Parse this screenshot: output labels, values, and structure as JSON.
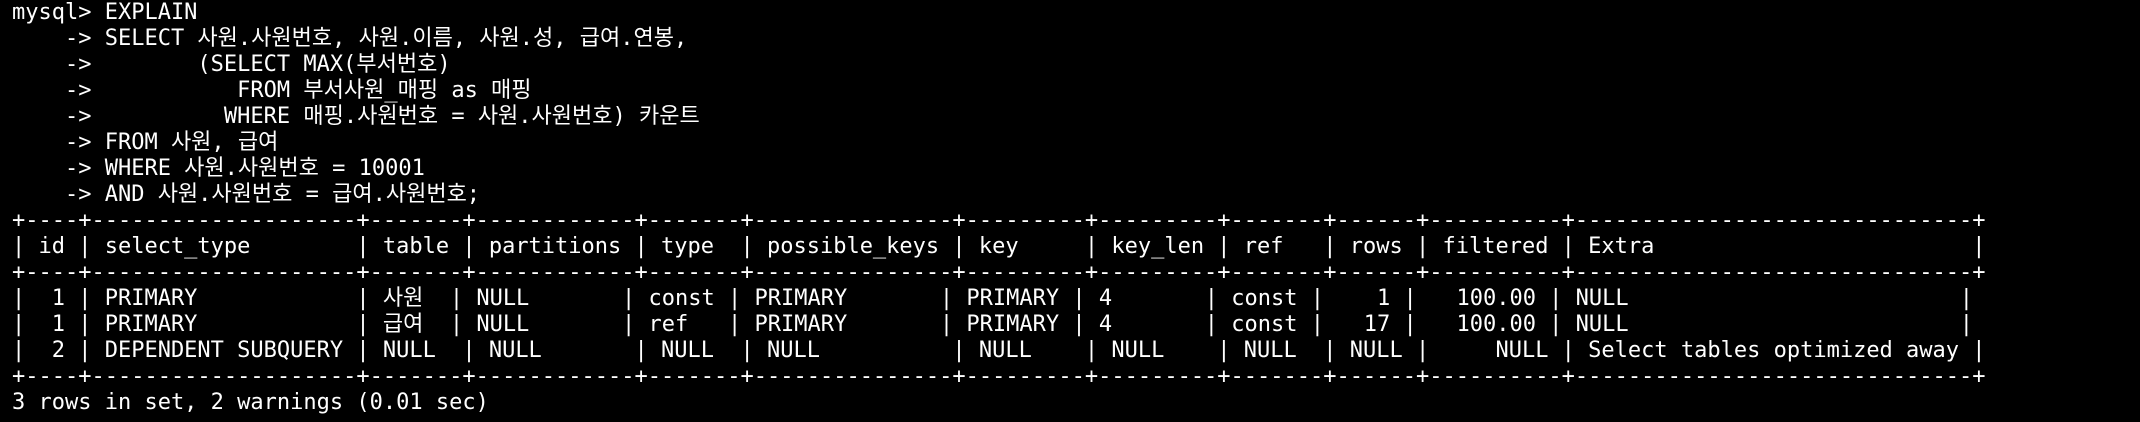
{
  "terminal": {
    "background": "#000000",
    "foreground": "#ffffff",
    "lines": [
      "mysql> EXPLAIN",
      "    -> SELECT 사원.사원번호, 사원.이름, 사원.성, 급여.연봉,",
      "    ->        (SELECT MAX(부서번호)",
      "    ->           FROM 부서사원_매핑 as 매핑",
      "    ->          WHERE 매핑.사원번호 = 사원.사원번호) 카운트",
      "    -> FROM 사원, 급여",
      "    -> WHERE 사원.사원번호 = 10001",
      "    -> AND 사원.사원번호 = 급여.사원번호;",
      "+----+--------------------+-------+------------+-------+---------------+---------+---------+-------+------+----------+------------------------------+",
      "| id | select_type        | table | partitions | type  | possible_keys | key     | key_len | ref   | rows | filtered | Extra                        |",
      "+----+--------------------+-------+------------+-------+---------------+---------+---------+-------+------+----------+------------------------------+",
      "|  1 | PRIMARY            | 사원  | NULL       | const | PRIMARY       | PRIMARY | 4       | const |    1 |   100.00 | NULL                         |",
      "|  1 | PRIMARY            | 급여  | NULL       | ref   | PRIMARY       | PRIMARY | 4       | const |   17 |   100.00 | NULL                         |",
      "|  2 | DEPENDENT SUBQUERY | NULL  | NULL       | NULL  | NULL          | NULL    | NULL    | NULL  | NULL |     NULL | Select tables optimized away |",
      "+----+--------------------+-------+------------+-------+---------------+---------+---------+-------+------+----------+------------------------------+",
      "3 rows in set, 2 warnings (0.01 sec)"
    ]
  }
}
